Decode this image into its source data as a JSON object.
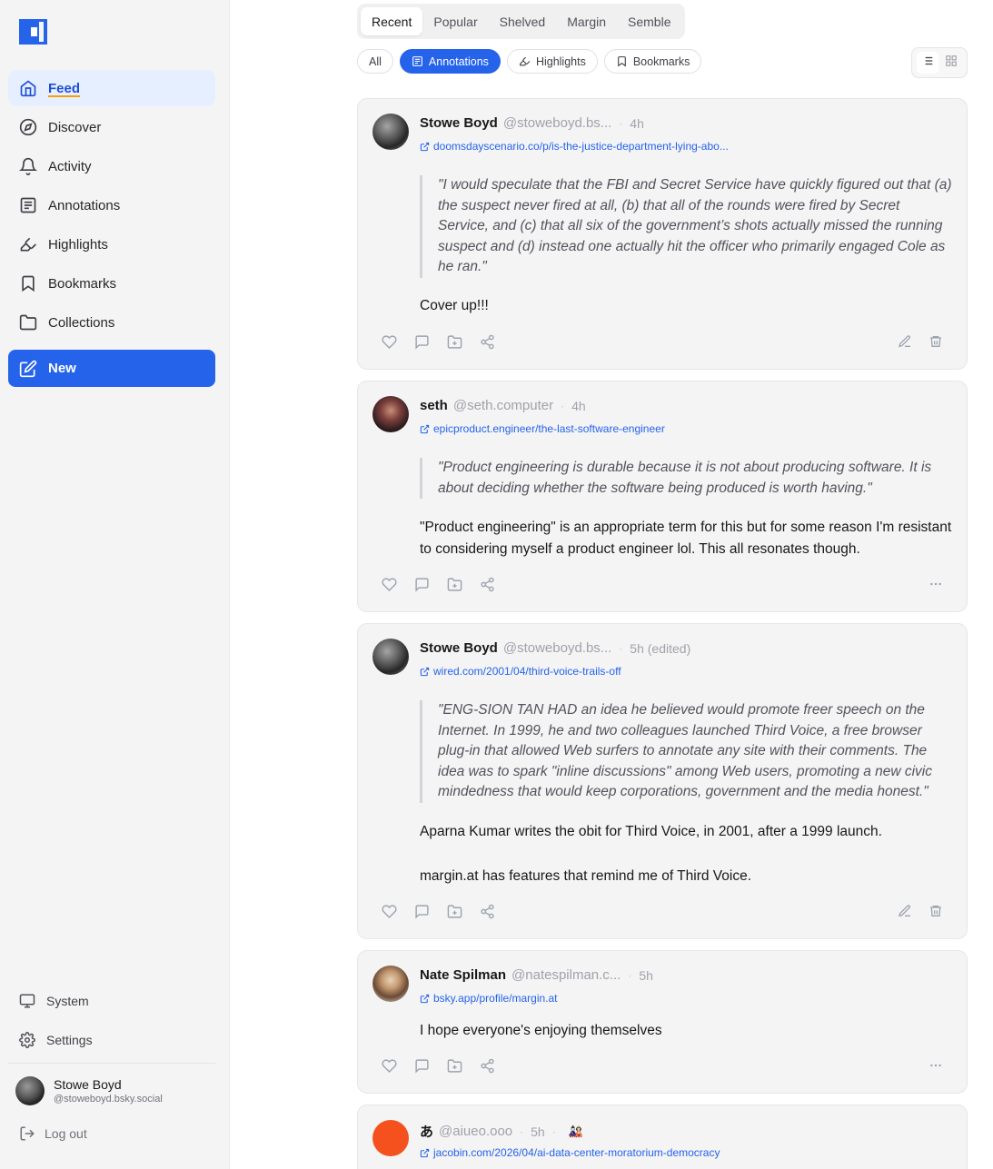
{
  "sidebar": {
    "logo": "margin-logo",
    "nav": [
      {
        "label": "Feed",
        "icon": "home-icon",
        "active": true
      },
      {
        "label": "Discover",
        "icon": "compass-icon"
      },
      {
        "label": "Activity",
        "icon": "bell-icon"
      },
      {
        "label": "Annotations",
        "icon": "annotation-icon"
      },
      {
        "label": "Highlights",
        "icon": "highlighter-icon"
      },
      {
        "label": "Bookmarks",
        "icon": "bookmark-icon"
      },
      {
        "label": "Collections",
        "icon": "folder-icon"
      }
    ],
    "new_label": "New",
    "system_label": "System",
    "settings_label": "Settings",
    "profile": {
      "name": "Stowe Boyd",
      "handle": "@stoweboyd.bsky.social"
    },
    "logout_label": "Log out"
  },
  "tabs": [
    "Recent",
    "Popular",
    "Shelved",
    "Margin",
    "Semble"
  ],
  "active_tab": "Recent",
  "filters": [
    {
      "label": "All"
    },
    {
      "label": "Annotations",
      "icon": "annotation-icon",
      "active": true
    },
    {
      "label": "Highlights",
      "icon": "highlighter-icon"
    },
    {
      "label": "Bookmarks",
      "icon": "bookmark-icon"
    }
  ],
  "posts": [
    {
      "name": "Stowe Boyd",
      "handle": "@stoweboyd.bs...",
      "time": "4h",
      "link": "doomsdayscenario.co/p/is-the-justice-department-lying-abo...",
      "quote": "\"I would speculate that the FBI and Secret Service have quickly figured out that (a) the suspect never fired at all, (b) that all of the rounds were fired by Secret Service, and (c) that all six of the government’s shots actually missed the running suspect and (d) instead one actually hit the officer who primarily engaged Cole as he ran.\"",
      "body": "Cover up!!!"
    },
    {
      "name": "seth",
      "handle": "@seth.computer",
      "time": "4h",
      "link": "epicproduct.engineer/the-last-software-engineer",
      "quote": "\"Product engineering is durable because it is not about producing software. It is about deciding whether the software being produced is worth having.\"",
      "body": "\"Product engineering\" is an appropriate term for this but for some reason I'm resistant to considering myself a product engineer lol. This all resonates though."
    },
    {
      "name": "Stowe Boyd",
      "handle": "@stoweboyd.bs...",
      "time": "5h (edited)",
      "link": "wired.com/2001/04/third-voice-trails-off",
      "quote": "\"ENG-SION TAN HAD an idea he believed would promote freer speech on the Internet. In 1999, he and two colleagues launched Third Voice, a free browser plug-in that allowed Web surfers to annotate any site with their comments. The idea was to spark \"inline discussions\" among Web users, promoting a new civic mindedness that would keep corporations, government and the media honest.\"",
      "body": "Aparna Kumar writes the obit for Third Voice, in 2001, after a 1999 launch.",
      "body2": "margin.at has features that remind me of Third Voice."
    },
    {
      "name": "Nate Spilman",
      "handle": "@natespilman.c...",
      "time": "5h",
      "link": "bsky.app/profile/margin.at",
      "body": "I hope everyone's enjoying themselves"
    },
    {
      "name": "あ",
      "handle": "@aiueo.ooo",
      "time": "5h",
      "emoji": "🎎",
      "link": "jacobin.com/2026/04/ai-data-center-moratorium-democracy"
    }
  ],
  "colors": {
    "accent": "#2563eb",
    "avatar_orange": "#f4511e"
  }
}
